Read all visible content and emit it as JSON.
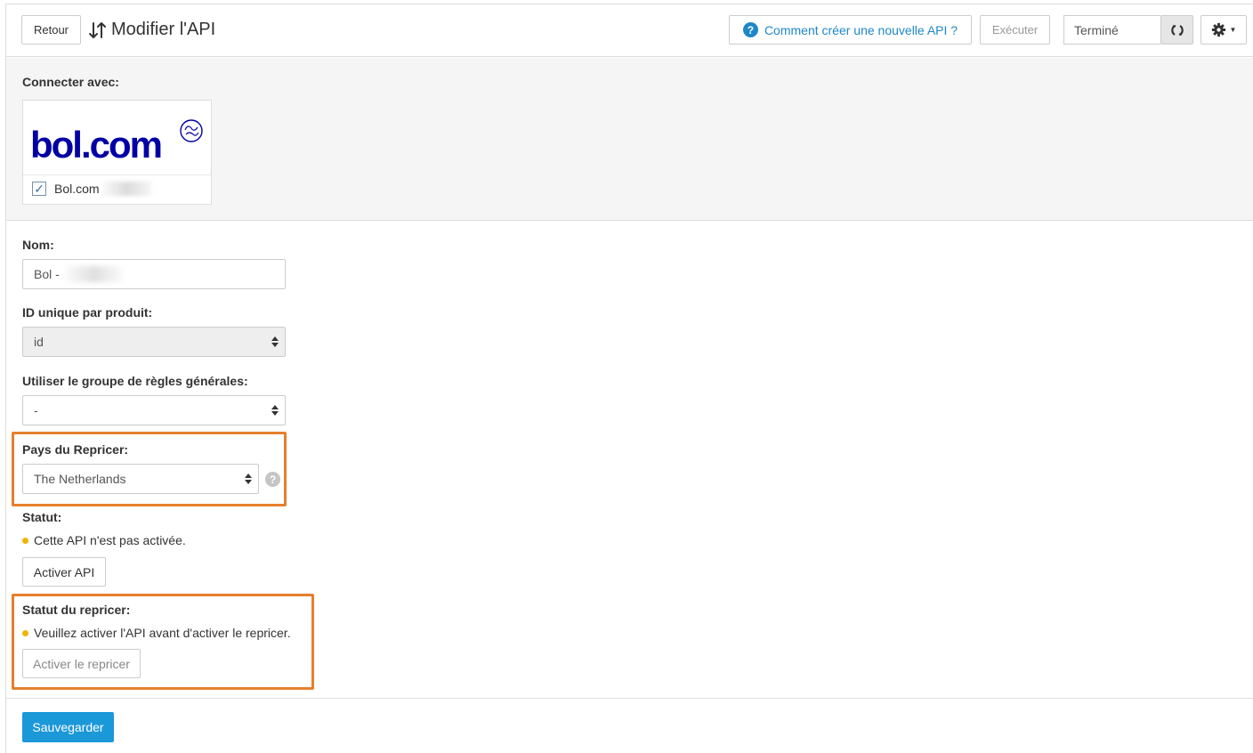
{
  "header": {
    "back_label": "Retour",
    "title": "Modifier l'API",
    "help_link_label": "Comment créer une nouvelle API ?",
    "execute_label": "Exécuter",
    "status_value": "Terminé"
  },
  "connect": {
    "label": "Connecter avec:",
    "logo_text": "bol.com",
    "option_label": "Bol.com",
    "option_checked": true
  },
  "form": {
    "name_label": "Nom:",
    "name_value": "Bol -",
    "unique_id_label": "ID unique par produit:",
    "unique_id_value": "id",
    "rule_group_label": "Utiliser le groupe de règles générales:",
    "rule_group_value": "-",
    "repricer_country_label": "Pays du Repricer:",
    "repricer_country_value": "The Netherlands",
    "status_label": "Statut:",
    "status_text": "Cette API n'est pas activée.",
    "activate_api_label": "Activer API",
    "repricer_status_label": "Statut du repricer:",
    "repricer_status_text": "Veuillez activer l'API avant d'activer le repricer.",
    "activate_repricer_label": "Activer le repricer",
    "save_label": "Sauvegarder"
  },
  "colors": {
    "accent": "#1b98d8",
    "link": "#1e87c9",
    "highlight": "#e57f2e",
    "status_dot": "#f0b400",
    "logo": "#0000a4"
  }
}
